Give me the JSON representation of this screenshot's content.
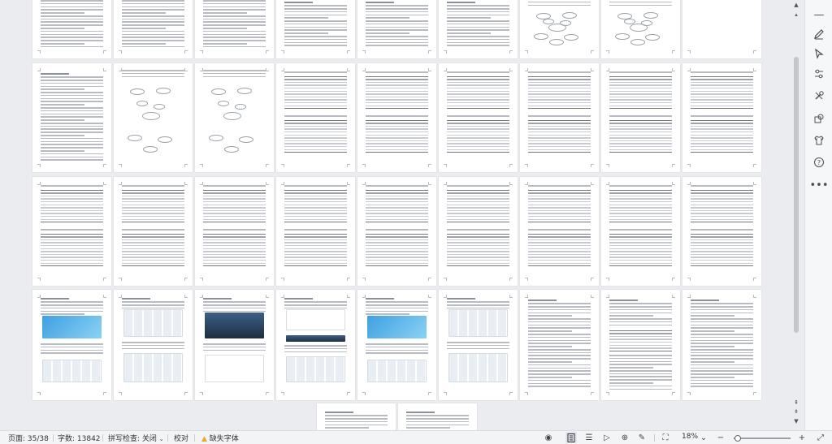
{
  "status_bar": {
    "page_info": "页面: 35/38",
    "word_count": "字数: 13842",
    "spell_check": "拼写检查: 关闭",
    "proofread": "校对",
    "missing_font": "缺失字体",
    "zoom": "18%"
  },
  "colors": {
    "workspace_bg": "#eaecef",
    "rail_bg": "#f6f7f9",
    "status_bg": "#f3f4f6",
    "warning": "#f5a623"
  },
  "rail_icons": [
    "minimize-icon",
    "pen-icon",
    "select-pointer-icon",
    "adjust-icon",
    "tools-icon",
    "shapes-icon",
    "shirt-icon",
    "help-icon",
    "more-icon"
  ],
  "thumbnail_pages": 38
}
